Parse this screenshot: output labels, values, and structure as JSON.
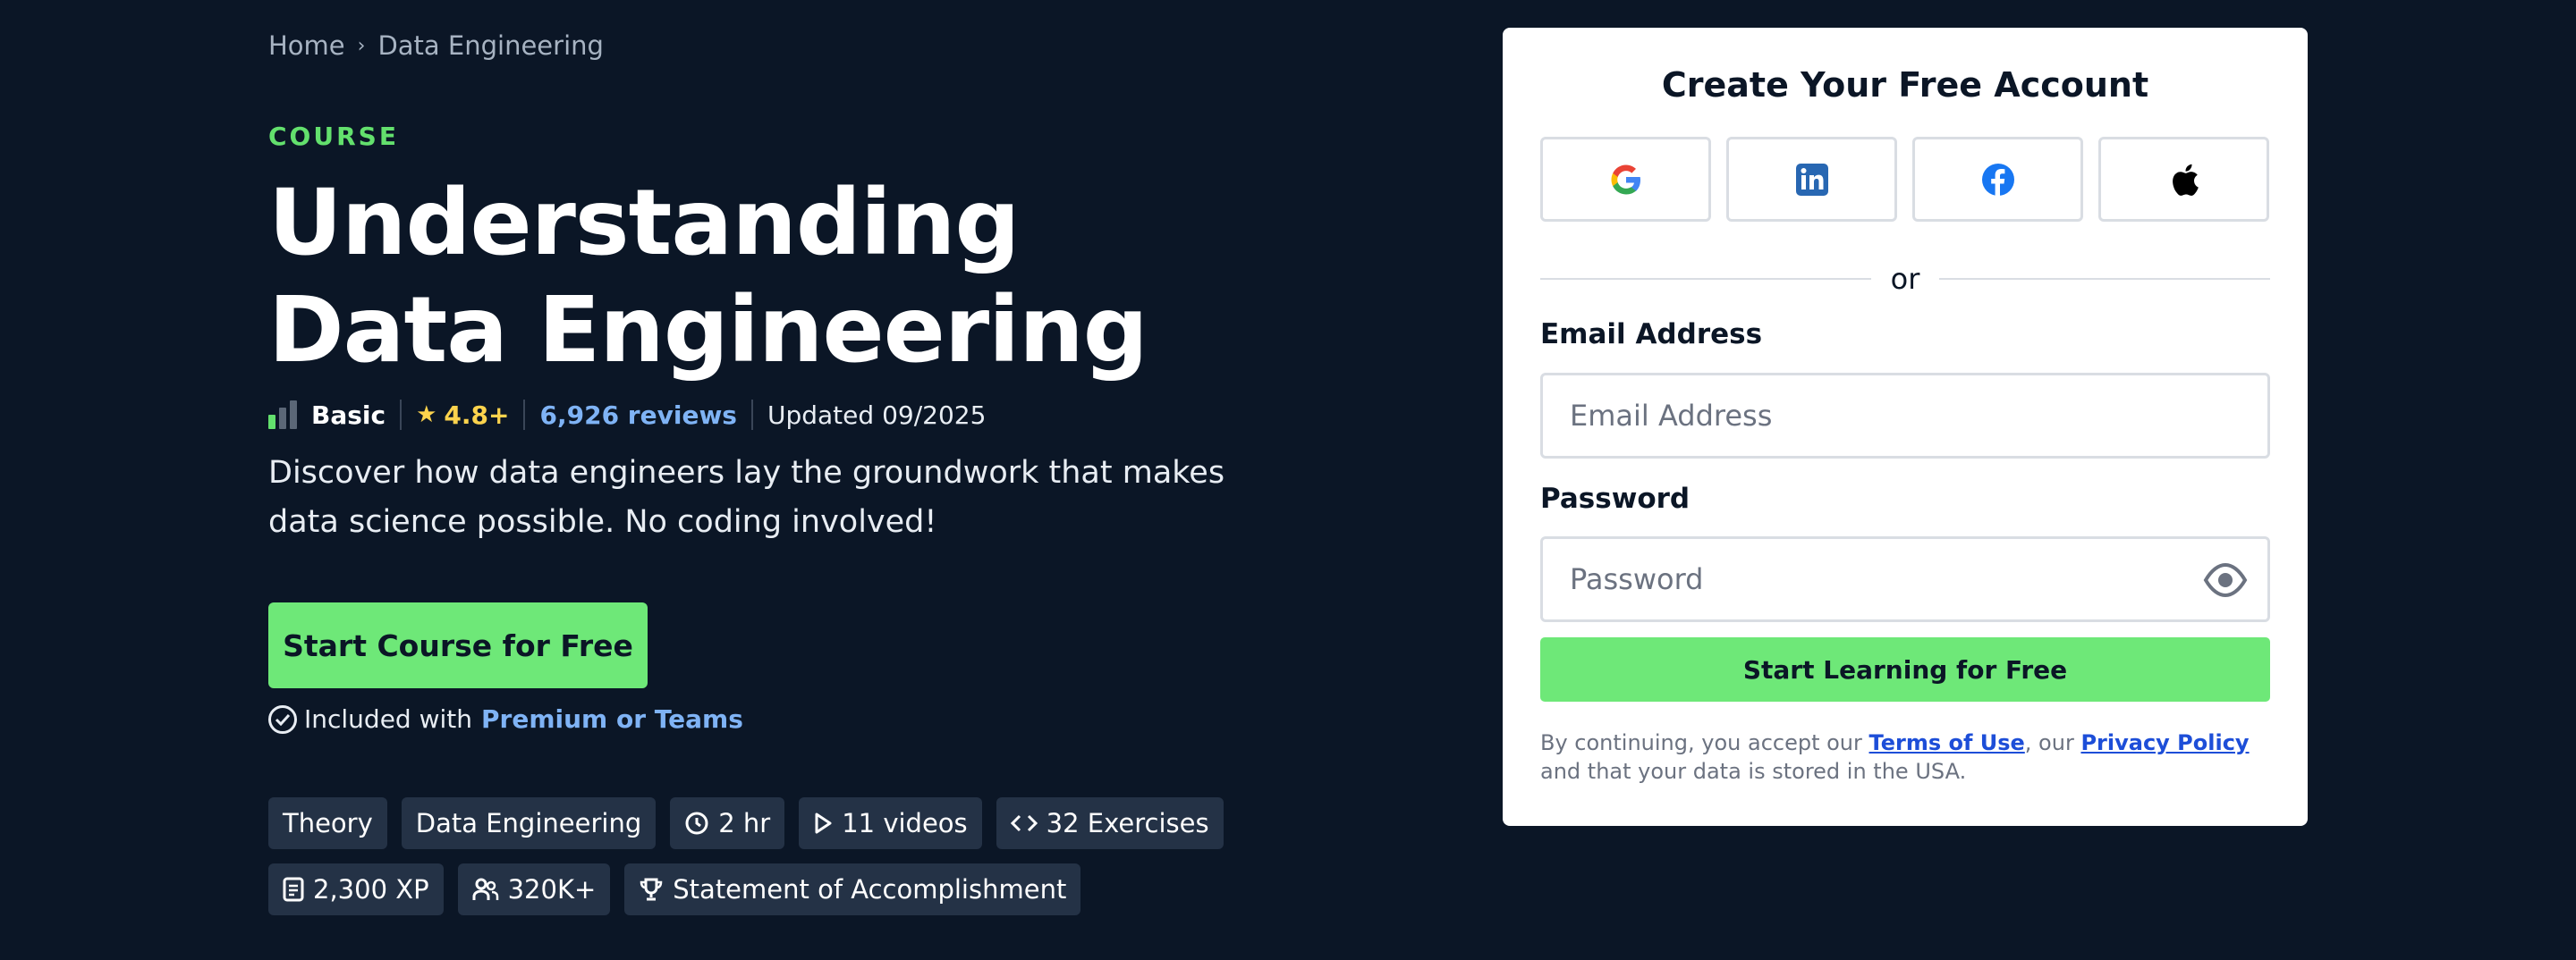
{
  "breadcrumb": {
    "home": "Home",
    "current": "Data Engineering"
  },
  "course": {
    "eyebrow": "COURSE",
    "title_line1": "Understanding",
    "title_line2": "Data Engineering",
    "level": "Basic",
    "rating": "4.8+",
    "reviews": "6,926 reviews",
    "updated": "Updated 09/2025",
    "description": "Discover how data engineers lay the groundwork that makes data science possible. No coding involved!",
    "cta_label": "Start Course for Free",
    "included_prefix": "Included with",
    "included_link": "Premium or Teams",
    "tags_row1": [
      "Theory",
      "Data Engineering",
      "2 hr",
      "11 videos",
      "32 Exercises"
    ],
    "tags_row2": [
      "2,300 XP",
      "320K+",
      "Statement of Accomplishment"
    ]
  },
  "signup": {
    "title": "Create Your Free Account",
    "social": [
      "google-icon",
      "linkedin-icon",
      "facebook-icon",
      "apple-icon"
    ],
    "or": "or",
    "email_label": "Email Address",
    "email_placeholder": "Email Address",
    "password_label": "Password",
    "password_placeholder": "Password",
    "submit_label": "Start Learning for Free",
    "legal_prefix": "By continuing, you accept our ",
    "terms": "Terms of Use",
    "legal_mid": ", our ",
    "privacy": "Privacy Policy",
    "legal_suffix": " and that your data is stored in the USA."
  },
  "colors": {
    "background": "#0b1626",
    "accent": "#6ee878",
    "link": "#7fb3f5",
    "star": "#fcd34d"
  }
}
